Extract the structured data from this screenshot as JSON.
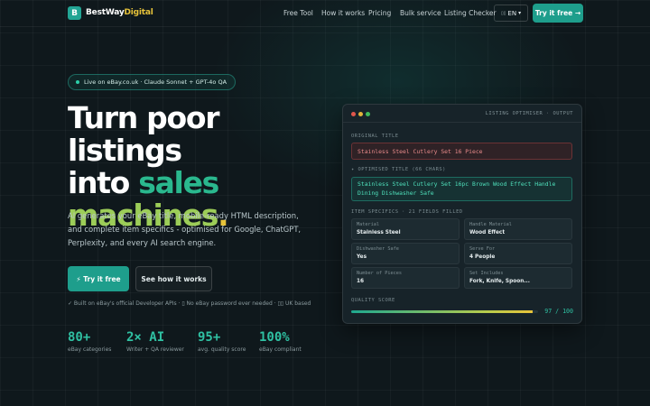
{
  "nav": {
    "logo_letter": "B",
    "brand_main": "BestWay",
    "brand_accent": "Digital",
    "links": [
      "Free Tool",
      "How it works",
      "Pricing",
      "Bulk service",
      "Listing Checker"
    ],
    "lang_flag": "▯▯",
    "lang": "EN",
    "lang_caret": "▾",
    "cta": "Try it free →"
  },
  "hero": {
    "badge": "Live on eBay.co.uk · Claude Sonnet + GPT-4o QA",
    "headline": {
      "line1": "Turn poor listings",
      "line2_pre": "into ",
      "line2_accent": "sales",
      "line3_accent": "machines",
      "line3_dot": "."
    },
    "description": "AI generates your eBay title, mobile-ready HTML description, and complete item specifics - optimised for Google, ChatGPT, Perplexity, and every AI search engine.",
    "primary_btn": "⚡ Try it free",
    "secondary_btn": "See how it works",
    "trust": "✓ Built on eBay's official Developer APIs · ▯ No eBay password ever needed · ▯▯ UK based"
  },
  "stats": [
    {
      "value": "80+",
      "label": "eBay categories"
    },
    {
      "value": "2× AI",
      "label": "Writer + QA reviewer"
    },
    {
      "value": "95+",
      "label": "avg. quality score"
    },
    {
      "value": "100%",
      "label": "eBay compliant"
    }
  ],
  "card": {
    "title": "LISTING OPTIMISER · OUTPUT",
    "original_label": "ORIGINAL TITLE",
    "original_value": "Stainless Steel Cutlery Set 16 Piece",
    "optimised_label": "✦ OPTIMISED TITLE (66 CHARS)",
    "optimised_value": "Stainless Steel Cutlery Set 16pc Brown Wood Effect Handle Dining Dishwasher Safe",
    "specifics_label": "ITEM SPECIFICS · 21 FIELDS FILLED",
    "specifics": [
      {
        "key": "Material",
        "value": "Stainless Steel"
      },
      {
        "key": "Handle Material",
        "value": "Wood Effect"
      },
      {
        "key": "Dishwasher Safe",
        "value": "Yes"
      },
      {
        "key": "Serve For",
        "value": "4 People"
      },
      {
        "key": "Number of Pieces",
        "value": "16"
      },
      {
        "key": "Set Includes",
        "value": "Fork, Knife, Spoon..."
      }
    ],
    "score_label": "QUALITY SCORE",
    "score_text": "97 / 100",
    "score_fraction": 0.97
  },
  "colors": {
    "accent_teal": "#1e9e8c",
    "accent_green": "#2ab88e",
    "accent_yellow": "#e7c33a",
    "background": "#0f181c"
  }
}
